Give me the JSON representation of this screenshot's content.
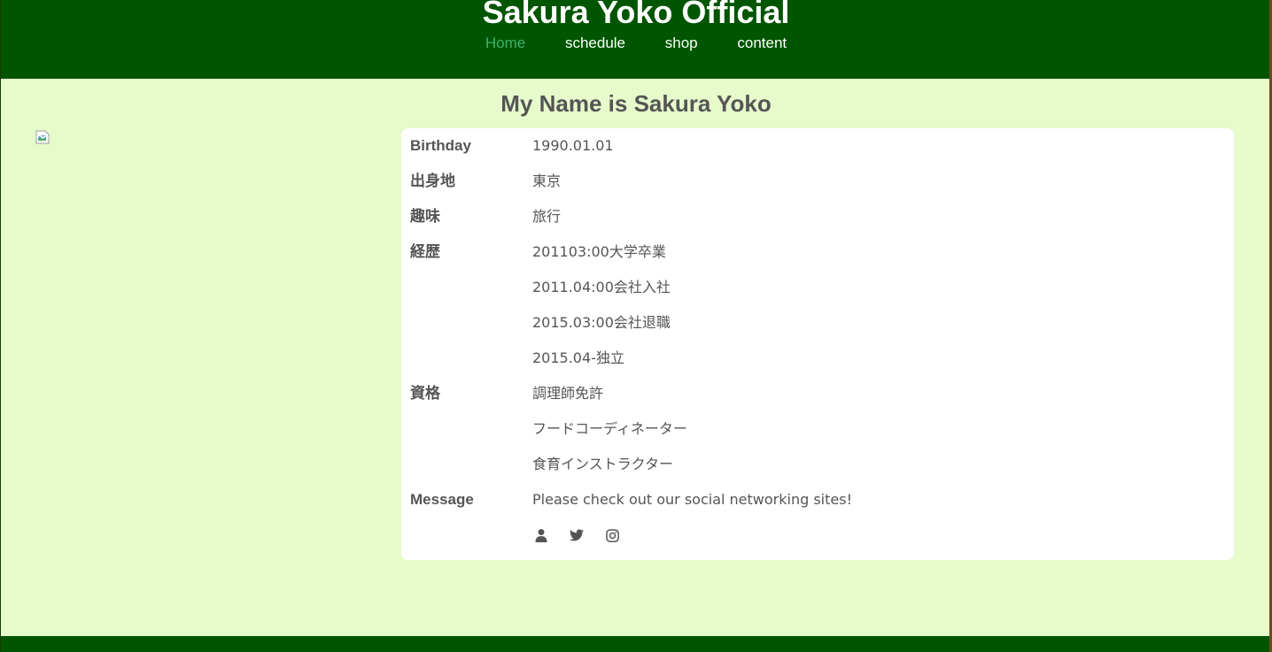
{
  "header": {
    "site_title": "Sakura Yoko Official",
    "nav": [
      {
        "label": "Home",
        "active": true
      },
      {
        "label": "schedule",
        "active": false
      },
      {
        "label": "shop",
        "active": false
      },
      {
        "label": "content",
        "active": false
      }
    ]
  },
  "main": {
    "heading": "My Name is Sakura Yoko",
    "profile_image": {
      "state": "broken",
      "icon": "broken-image-icon"
    },
    "profile": {
      "birthday": {
        "label": "Birthday",
        "value": "1990.01.01"
      },
      "birthplace": {
        "label": "出身地",
        "value": "東京"
      },
      "hobby": {
        "label": "趣味",
        "value": "旅行"
      },
      "career": {
        "label": "経歴",
        "values": [
          "201103:00大学卒業",
          "2011.04:00会社入社",
          "2015.03:00会社退職",
          "2015.04-独立"
        ]
      },
      "qualifications": {
        "label": "資格",
        "values": [
          "調理師免許",
          "フードコーディネーター",
          "食育インストラクター"
        ]
      },
      "message": {
        "label": "Message",
        "value": "Please check out our social networking sites!"
      },
      "social": [
        "person-icon",
        "twitter-icon",
        "instagram-icon"
      ]
    }
  },
  "colors": {
    "header_bg": "#005500",
    "page_bg": "#e6facc",
    "nav_active": "#3cb371",
    "text": "#555555",
    "card_bg": "#ffffff"
  }
}
